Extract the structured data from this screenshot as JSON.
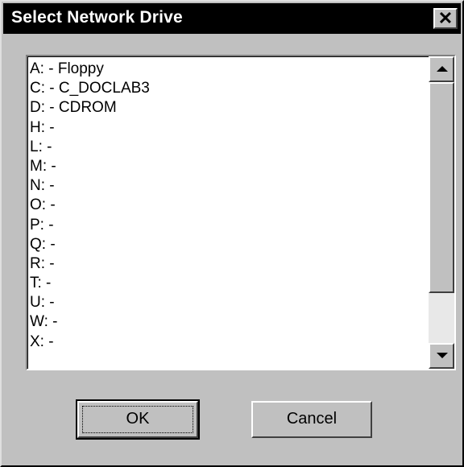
{
  "window": {
    "title": "Select Network Drive",
    "close_symbol": "✕"
  },
  "drive_list": {
    "items": [
      "A: - Floppy",
      "C: - C_DOCLAB3",
      "D: - CDROM",
      "H: -",
      "L: -",
      "M: -",
      "N: -",
      "O: -",
      "P: -",
      "Q: -",
      "R: -",
      "T: -",
      "U: -",
      "W: -",
      "X: -"
    ]
  },
  "buttons": {
    "ok_label": "OK",
    "cancel_label": "Cancel"
  },
  "icons": {
    "close": "close-icon",
    "scroll_up": "arrow-up-icon",
    "scroll_down": "arrow-down-icon"
  },
  "colors": {
    "titlebar": "#000000",
    "dialog_face": "#c0c0c0",
    "list_background": "#ffffff"
  }
}
